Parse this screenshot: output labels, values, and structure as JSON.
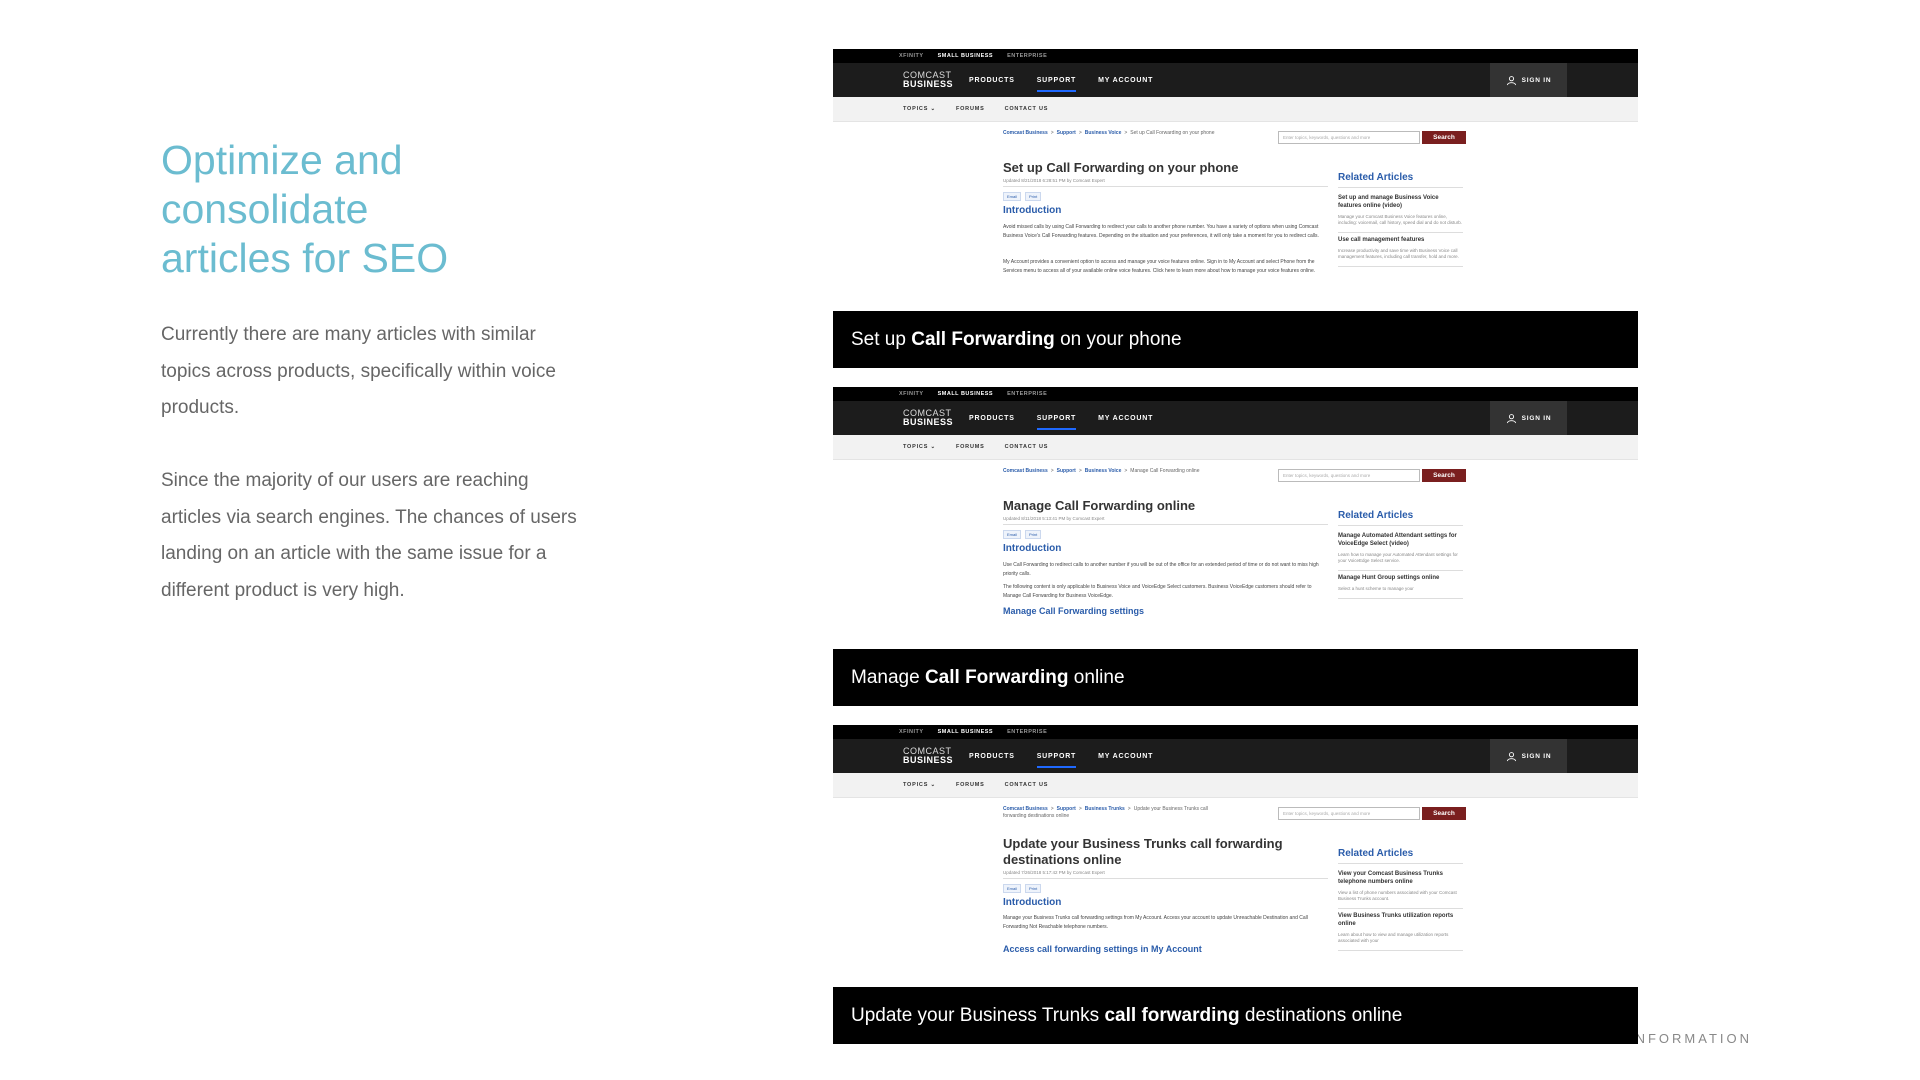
{
  "slide": {
    "title_lines": [
      "Optimize and",
      "consolidate",
      "articles for SEO"
    ],
    "paragraph_1": "Currently there are many articles with similar topics across products, specifically within voice products.",
    "paragraph_2": "Since the majority of our users are reaching articles via search engines. The chances of users landing on an article with the same issue for a different product is very high.",
    "footer_text": "ST INFORMATION"
  },
  "site": {
    "util_links": [
      "XFINITY",
      "SMALL BUSINESS",
      "ENTERPRISE"
    ],
    "logo_line1": "COMCAST",
    "logo_line2": "BUSINESS",
    "nav": [
      "PRODUCTS",
      "SUPPORT",
      "MY ACCOUNT"
    ],
    "sign_in": "SIGN IN",
    "subnav": [
      "TOPICS",
      "FORUMS",
      "CONTACT US"
    ],
    "search_placeholder": "Enter topics, keywords, questions and more",
    "search_button": "Search",
    "email_label": "Email",
    "print_label": "Print",
    "related_heading": "Related Articles",
    "intro_heading": "Introduction",
    "crumb_root": "Comcast Business",
    "crumb_support": "Support"
  },
  "screenshots": [
    {
      "crumb_product": "Business Voice",
      "crumb_current": "Set up Call Forwarding on your phone",
      "heading": "Set up Call Forwarding on your phone",
      "updated": "Updated 8/21/2018 6:28:51 PM by Comcast Expert",
      "body_1": "Avoid missed calls by using Call Forwarding to redirect your calls to another phone number. You have a variety of options when using Comcast Business Voice's Call Forwarding features. Depending on the situation and your preferences, it will only take a moment for you to redirect calls.",
      "body_2": "My Account provides a convenient option to access and manage your voice features online. Sign in to My Account and select Phone from the Services menu to access all of your available online voice features. Click here to learn more about how to manage your voice features online.",
      "related": [
        {
          "title": "Set up and manage Business Voice features online (video)",
          "desc": "Manage your Comcast Business Voice features online, including: voicemail, call history, speed dial and do not disturb."
        },
        {
          "title": "Use call management features",
          "desc": "Increase productivity and save time with Business Voice call management features, including call transfer, hold and more."
        }
      ],
      "caption_pre": "Set up ",
      "caption_bold": "Call Forwarding",
      "caption_post": " on your phone"
    },
    {
      "crumb_product": "Business Voice",
      "crumb_current": "Manage Call Forwarding online",
      "heading": "Manage Call Forwarding online",
      "updated": "Updated 8/11/2018 5:13:41 PM by Comcast Expert",
      "body_1": "Use Call Forwarding to redirect calls to another number if you will be out of the office for an extended period of time or do not want to miss high priority calls.",
      "body_2": "The following content is only applicable to Business Voice and VoiceEdge Select customers. Business VoiceEdge customers should refer to Manage Call Forwarding for Business VoiceEdge.",
      "subheading": "Manage Call Forwarding settings",
      "related": [
        {
          "title": "Manage Automated Attendant settings for VoiceEdge Select (video)",
          "desc": "Learn how to manage your Automated Attendant settings for your VoiceEdge Select service."
        },
        {
          "title": "Manage Hunt Group settings online",
          "desc": "Select a hunt scheme to manage your"
        }
      ],
      "caption_pre": "Manage ",
      "caption_bold": "Call Forwarding",
      "caption_post": " online"
    },
    {
      "crumb_product": "Business Trunks",
      "crumb_current": "Update your Business Trunks call forwarding destinations online",
      "heading": "Update your Business Trunks call forwarding destinations online",
      "updated": "Updated 7/26/2018 5:17:42 PM by Comcast Expert",
      "body_1": "Manage your Business Trunks call forwarding settings from My Account. Access your account to update Unreachable Destination and Call Forwarding Not Reachable telephone numbers.",
      "subheading": "Access call forwarding settings in My Account",
      "related": [
        {
          "title": "View your Comcast Business Trunks telephone numbers online",
          "desc": "View a list of phone numbers associated with your Comcast Business Trunks account."
        },
        {
          "title": "View Business Trunks utilization reports online",
          "desc": "Learn about how to view and manage utilization reports associated with your"
        }
      ],
      "caption_pre": "Update your Business Trunks ",
      "caption_bold": "call forwarding",
      "caption_post": " destinations online"
    }
  ]
}
